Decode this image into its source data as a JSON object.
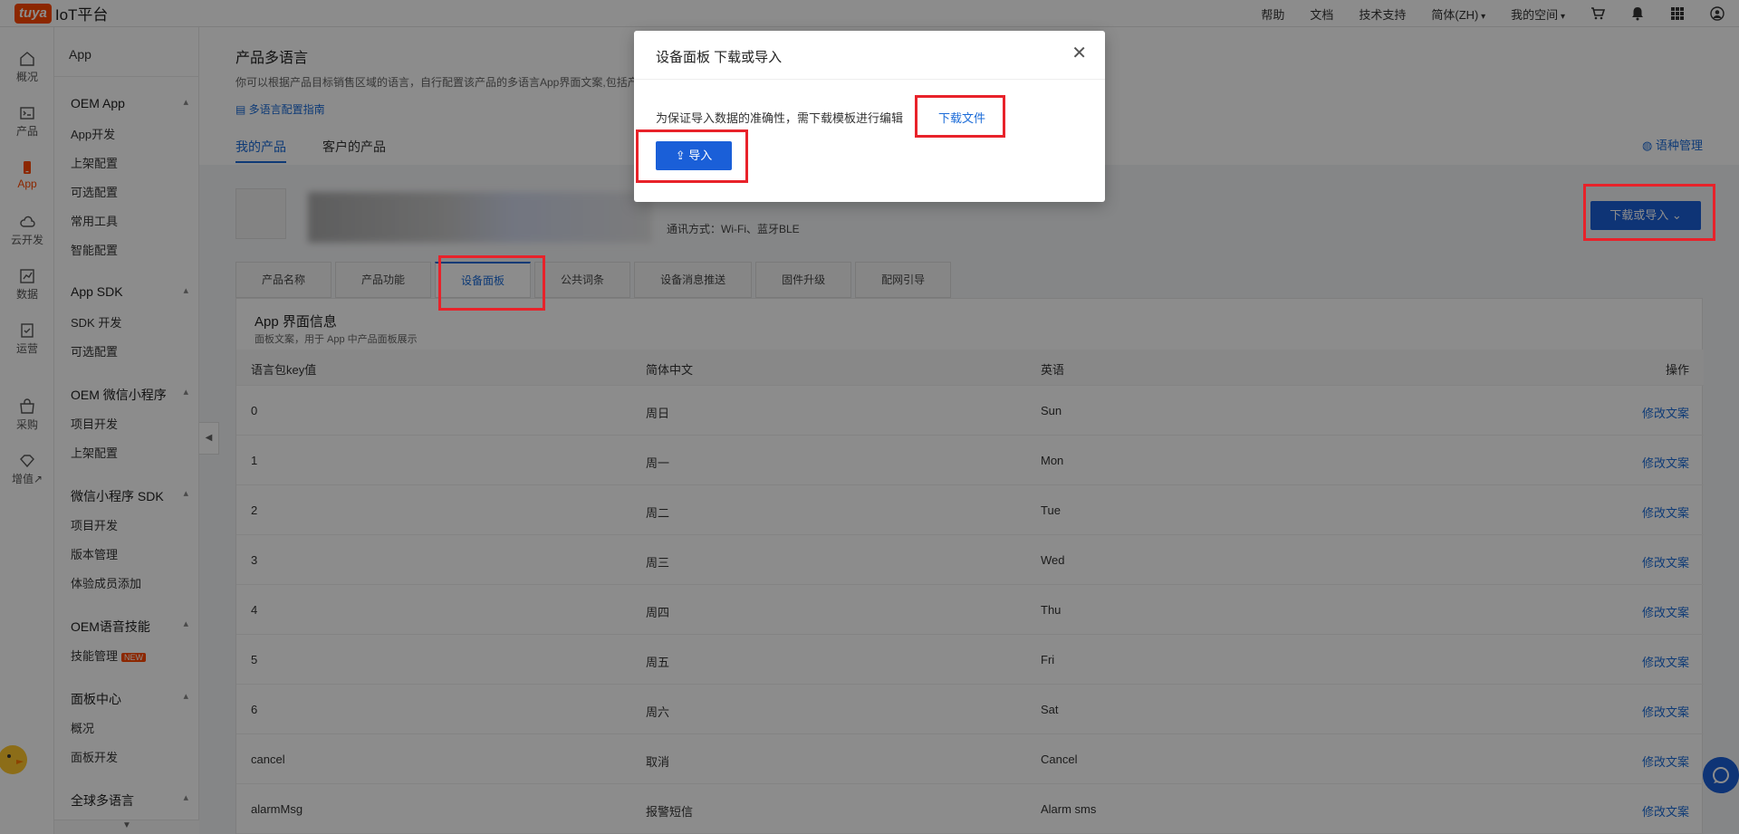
{
  "topbar": {
    "logo_badge": "tuya",
    "logo_text": "IoT平台",
    "links": [
      "帮助",
      "文档",
      "技术支持"
    ],
    "language": "简体(ZH)",
    "space": "我的空间"
  },
  "rail": {
    "items": [
      {
        "label": "概况",
        "icon": "home-icon"
      },
      {
        "label": "产品",
        "icon": "terminal-icon"
      },
      {
        "label": "App",
        "icon": "phone-icon"
      },
      {
        "label": "云开发",
        "icon": "cloud-icon"
      },
      {
        "label": "数据",
        "icon": "chart-icon"
      },
      {
        "label": "运营",
        "icon": "operate-icon"
      },
      {
        "label": "采购",
        "icon": "store-icon"
      },
      {
        "label": "增值",
        "icon": "diamond-icon"
      }
    ]
  },
  "sidebar": {
    "title": "App",
    "groups": [
      {
        "label": "OEM App",
        "items": [
          "App开发",
          "上架配置",
          "可选配置",
          "常用工具",
          "智能配置"
        ]
      },
      {
        "label": "App SDK",
        "items": [
          "SDK 开发",
          "可选配置"
        ]
      },
      {
        "label": "OEM 微信小程序",
        "items": [
          "项目开发",
          "上架配置"
        ]
      },
      {
        "label": "微信小程序 SDK",
        "items": [
          "项目开发",
          "版本管理",
          "体验成员添加"
        ]
      },
      {
        "label": "OEM语音技能",
        "items": [
          "技能管理"
        ]
      },
      {
        "label": "面板中心",
        "items": [
          "概况",
          "面板开发"
        ]
      },
      {
        "label": "全球多语言",
        "items": []
      }
    ],
    "new_badge": "NEW"
  },
  "header": {
    "title": "产品多语言",
    "desc": "你可以根据产品目标销售区域的语言，自行配置该产品的多语言App界面文案,包括产",
    "guide": "多语言配置指南",
    "tabs": [
      "我的产品",
      "客户的产品"
    ],
    "lang_mgr": "语种管理"
  },
  "product": {
    "comm": "通讯方式：Wi-Fi、蓝牙BLE",
    "download_import": "下载或导入",
    "sub_tabs": [
      "产品名称",
      "产品功能",
      "设备面板",
      "公共词条",
      "设备消息推送",
      "固件升级",
      "配网引导"
    ]
  },
  "panel": {
    "title": "App 界面信息",
    "subtitle": "面板文案，用于 App 中产品面板展示",
    "columns": [
      "语言包key值",
      "简体中文",
      "英语",
      "操作"
    ],
    "rows": [
      {
        "key": "0",
        "zh": "周日",
        "en": "Sun"
      },
      {
        "key": "1",
        "zh": "周一",
        "en": "Mon"
      },
      {
        "key": "2",
        "zh": "周二",
        "en": "Tue"
      },
      {
        "key": "3",
        "zh": "周三",
        "en": "Wed"
      },
      {
        "key": "4",
        "zh": "周四",
        "en": "Thu"
      },
      {
        "key": "5",
        "zh": "周五",
        "en": "Fri"
      },
      {
        "key": "6",
        "zh": "周六",
        "en": "Sat"
      },
      {
        "key": "cancel",
        "zh": "取消",
        "en": "Cancel"
      },
      {
        "key": "alarmMsg",
        "zh": "报警短信",
        "en": "Alarm sms"
      }
    ],
    "action_label": "修改文案"
  },
  "modal": {
    "title": "设备面板 下载或导入",
    "text": "为保证导入数据的准确性，需下载模板进行编辑",
    "download_file": "下载文件",
    "import": "导入"
  },
  "colors": {
    "brand": "#ff4800",
    "primary": "#1a5fd8",
    "highlight": "#e8222a"
  }
}
